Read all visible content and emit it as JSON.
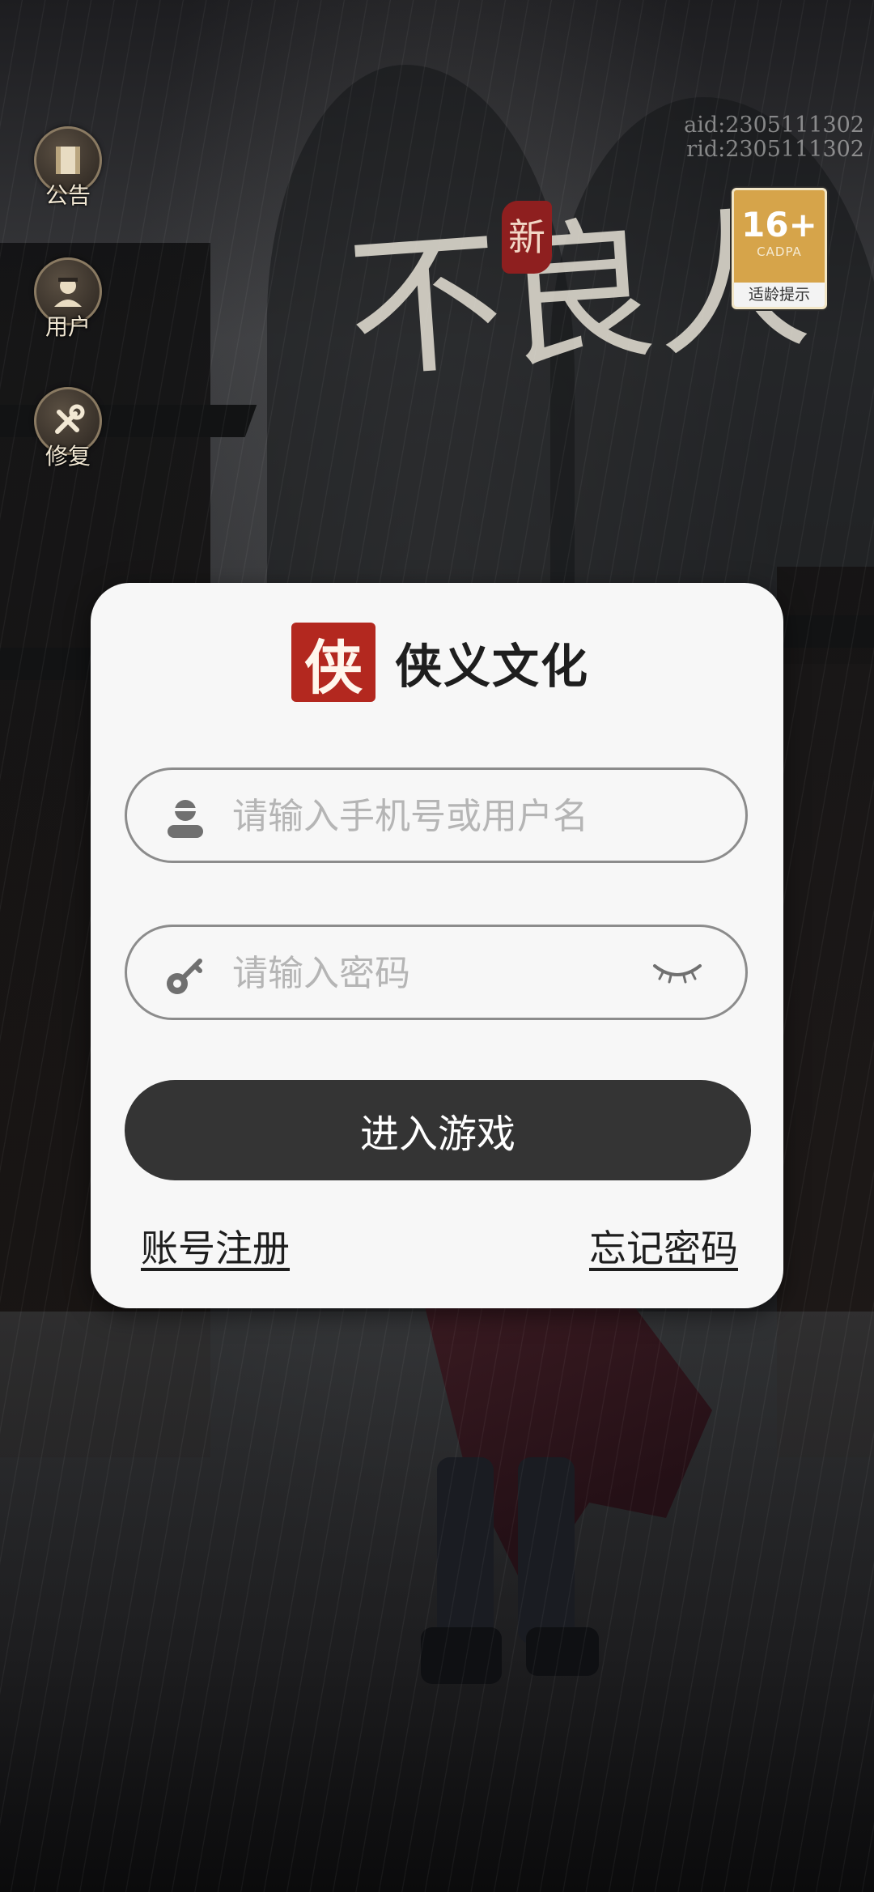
{
  "ids": {
    "aid": "aid:2305111302",
    "rid": "rid:2305111302"
  },
  "side_menu": [
    {
      "label": "公告",
      "icon": "scroll-icon"
    },
    {
      "label": "用户",
      "icon": "character-icon"
    },
    {
      "label": "修复",
      "icon": "wrench-icon"
    }
  ],
  "age_badge": {
    "rating": "16+",
    "brand": "CADPA",
    "tip": "适龄提示"
  },
  "game_title": {
    "seal": "新",
    "calligraphy": "不良人"
  },
  "dialog": {
    "brand_seal": "侠",
    "brand_name": "侠义文化",
    "username_placeholder": "请输入手机号或用户名",
    "password_placeholder": "请输入密码",
    "enter_button": "进入游戏",
    "register_link": "账号注册",
    "forgot_link": "忘记密码"
  },
  "colors": {
    "dialog_bg": "#f7f7f7",
    "button_bg": "#343434",
    "seal_red": "#b3281f",
    "badge_gold": "#d6a44a"
  }
}
